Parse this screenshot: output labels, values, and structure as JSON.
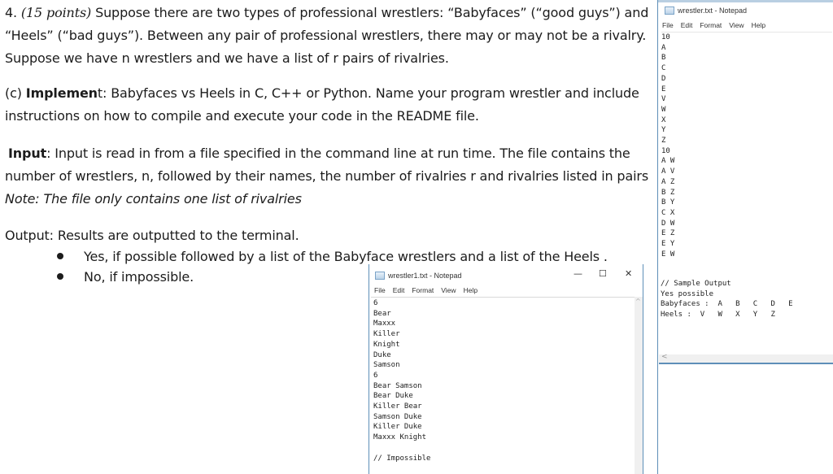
{
  "problem": {
    "number": "4.",
    "points": "(15 points)",
    "intro": [
      "Suppose there are two types of professional wrestlers: “Babyfaces” (“good guys”) and",
      "“Heels” (“bad guys”).  Between any pair of professional wrestlers, there may or may not be a rivalry.",
      "Suppose we have n wrestlers and we have a list of r pairs of rivalries."
    ],
    "part_c": {
      "label": "(c) ",
      "bold_word": "Implemen",
      "rest_word": "t",
      "line1": ":  Babyfaces vs Heels in C, C++ or Python. Name your program wrestler and include",
      "line2": "instructions on how to compile and execute your code in the README file."
    },
    "input": {
      "label": "Input",
      "line1": ":  Input is read in from a file specified in the command line at run time.  The file contains the",
      "line2": "number of wrestlers, n, followed by their names, the number of rivalries r and rivalries listed in pairs",
      "note": "Note: The file only contains one list of rivalries"
    },
    "output": {
      "line": "Output:  Results are outputted to the terminal.",
      "bullets": [
        "Yes, if possible followed by a list of the Babyface wrestlers and a list of the Heels .",
        "No, if impossible."
      ]
    }
  },
  "notepad_main": {
    "title": "wrestler.txt - Notepad",
    "menu": [
      "File",
      "Edit",
      "Format",
      "View",
      "Help"
    ],
    "content": "10\nA\nB\nC\nD\nE\nV\nW\nX\nY\nZ\n10\nA W\nA V\nA Z\nB Z\nB Y\nC X\nD W\nE Z\nE Y\nE W",
    "sample_output": "// Sample Output\nYes possible\nBabyfaces :  A   B   C   D   E\nHeels :  V   W   X   Y   Z"
  },
  "notepad_second": {
    "title": "wrestler1.txt - Notepad",
    "menu": [
      "File",
      "Edit",
      "Format",
      "View",
      "Help"
    ],
    "controls": {
      "minimize": "—",
      "maximize": "☐",
      "close": "✕"
    },
    "content": "6\nBear\nMaxxx\nKiller\nKnight\nDuke\nSamson\n6\nBear Samson\nBear Duke\nKiller Bear\nSamson Duke\nKiller Duke\nMaxxx Knight\n\n// Impossible"
  }
}
